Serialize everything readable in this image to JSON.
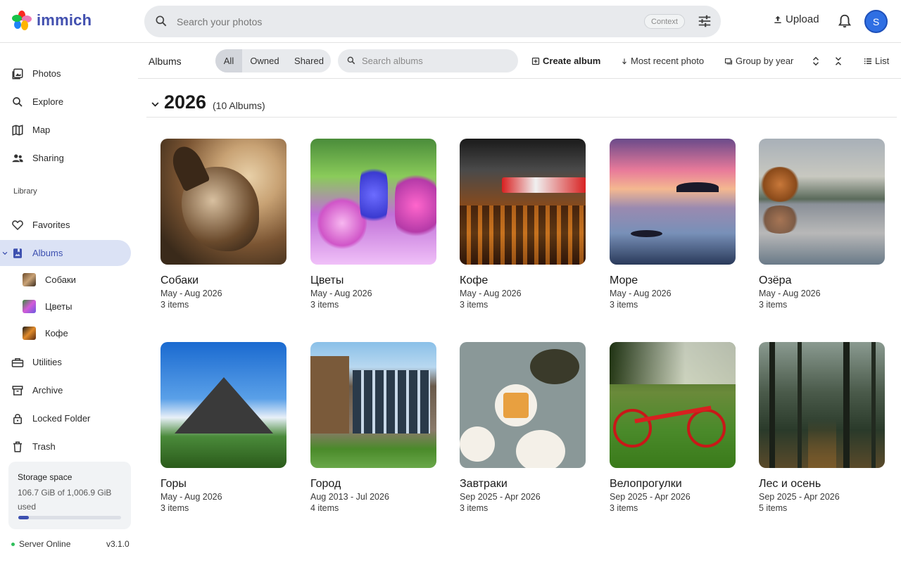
{
  "app": {
    "name": "immich",
    "brand_color": "#4250af"
  },
  "header": {
    "search_placeholder": "Search your photos",
    "context_label": "Context",
    "upload_label": "Upload",
    "avatar_initial": "S"
  },
  "sidebar": {
    "items": [
      {
        "label": "Photos",
        "icon": "photos-icon"
      },
      {
        "label": "Explore",
        "icon": "search-icon"
      },
      {
        "label": "Map",
        "icon": "map-icon"
      },
      {
        "label": "Sharing",
        "icon": "people-icon"
      }
    ],
    "library_label": "Library",
    "library_items": [
      {
        "label": "Favorites",
        "icon": "heart-icon"
      },
      {
        "label": "Albums",
        "icon": "album-icon",
        "active": true
      }
    ],
    "album_children": [
      {
        "label": "Собаки"
      },
      {
        "label": "Цветы"
      },
      {
        "label": "Кофе"
      }
    ],
    "more_items": [
      {
        "label": "Utilities",
        "icon": "toolbox-icon"
      },
      {
        "label": "Archive",
        "icon": "archive-icon"
      },
      {
        "label": "Locked Folder",
        "icon": "lock-icon"
      },
      {
        "label": "Trash",
        "icon": "trash-icon"
      }
    ],
    "storage": {
      "title": "Storage space",
      "usage": "106.7 GiB of 1,006.9 GiB used",
      "used_fraction": 0.106
    },
    "server_status": "Server Online",
    "version": "v3.1.0"
  },
  "toolbar": {
    "title": "Albums",
    "filters": [
      "All",
      "Owned",
      "Shared"
    ],
    "selected_filter": "All",
    "search_placeholder": "Search albums",
    "create_label": "Create album",
    "sort_label": "Most recent photo",
    "group_label": "Group by year",
    "view_label": "List"
  },
  "group": {
    "year": "2026",
    "count_label": "(10 Albums)"
  },
  "albums": [
    {
      "name": "Собаки",
      "dates": "May - Aug 2026",
      "count": "3 items"
    },
    {
      "name": "Цветы",
      "dates": "May - Aug 2026",
      "count": "3 items"
    },
    {
      "name": "Кофе",
      "dates": "May - Aug 2026",
      "count": "3 items"
    },
    {
      "name": "Море",
      "dates": "May - Aug 2026",
      "count": "3 items"
    },
    {
      "name": "Озёра",
      "dates": "May - Aug 2026",
      "count": "3 items"
    },
    {
      "name": "Горы",
      "dates": "May - Aug 2026",
      "count": "3 items"
    },
    {
      "name": "Город",
      "dates": "Aug 2013 - Jul 2026",
      "count": "4 items"
    },
    {
      "name": "Завтраки",
      "dates": "Sep 2025 - Apr 2026",
      "count": "3 items"
    },
    {
      "name": "Велопрогулки",
      "dates": "Sep 2025 - Apr 2026",
      "count": "3 items"
    },
    {
      "name": "Лес и осень",
      "dates": "Sep 2025 - Apr 2026",
      "count": "5 items"
    }
  ]
}
